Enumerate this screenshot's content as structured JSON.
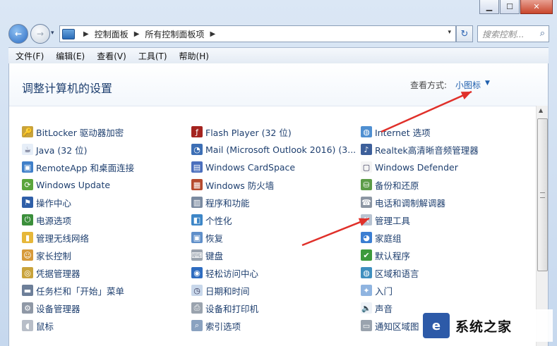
{
  "window": {
    "minimize": "▁",
    "maximize": "☐",
    "close": "✕"
  },
  "nav": {
    "back": "←",
    "forward": "→",
    "history": "▾",
    "breadcrumb": [
      "控制面板",
      "所有控制面板项"
    ],
    "crumb_sep": "▶",
    "dropdown": "▾",
    "refresh": "↻",
    "search_placeholder": "搜索控制...",
    "search_icon": "⌕"
  },
  "menu": [
    "文件(F)",
    "编辑(E)",
    "查看(V)",
    "工具(T)",
    "帮助(H)"
  ],
  "header": {
    "title": "调整计算机的设置",
    "view_label": "查看方式:",
    "view_value": "小图标",
    "view_caret": "▼"
  },
  "scrollbar": {
    "up": "▲"
  },
  "columns": [
    [
      {
        "label": "BitLocker 驱动器加密",
        "icon": "bitlocker-icon",
        "glyph": "🔑",
        "color": "#c9a33b"
      },
      {
        "label": "Java (32 位)",
        "icon": "java-icon",
        "glyph": "☕",
        "color": "#e6eef8"
      },
      {
        "label": "RemoteApp 和桌面连接",
        "icon": "remoteapp-icon",
        "glyph": "▣",
        "color": "#3f7fc9"
      },
      {
        "label": "Windows Update",
        "icon": "windows-update-icon",
        "glyph": "⟳",
        "color": "#5aa53c"
      },
      {
        "label": "操作中心",
        "icon": "action-center-icon",
        "glyph": "⚑",
        "color": "#2f5fa8"
      },
      {
        "label": "电源选项",
        "icon": "power-options-icon",
        "glyph": "⏻",
        "color": "#3b8f3b"
      },
      {
        "label": "管理无线网络",
        "icon": "wireless-icon",
        "glyph": "▮",
        "color": "#e6b73a"
      },
      {
        "label": "家长控制",
        "icon": "parental-controls-icon",
        "glyph": "☺",
        "color": "#d79a3a"
      },
      {
        "label": "凭据管理器",
        "icon": "credential-manager-icon",
        "glyph": "◎",
        "color": "#c9a33b"
      },
      {
        "label": "任务栏和「开始」菜单",
        "icon": "taskbar-icon",
        "glyph": "▬",
        "color": "#6d7f99"
      },
      {
        "label": "设备管理器",
        "icon": "device-manager-icon",
        "glyph": "⚙",
        "color": "#8f98a6"
      },
      {
        "label": "鼠标",
        "icon": "mouse-icon",
        "glyph": "◖",
        "color": "#b8bec8"
      }
    ],
    [
      {
        "label": "Flash Player (32 位)",
        "icon": "flash-player-icon",
        "glyph": "ƒ",
        "color": "#a4231f"
      },
      {
        "label": "Mail (Microsoft Outlook 2016) (3...",
        "icon": "mail-icon",
        "glyph": "◔",
        "color": "#3d6fb5"
      },
      {
        "label": "Windows CardSpace",
        "icon": "cardspace-icon",
        "glyph": "▤",
        "color": "#4b6fbd"
      },
      {
        "label": "Windows 防火墙",
        "icon": "firewall-icon",
        "glyph": "▦",
        "color": "#b64b2e"
      },
      {
        "label": "程序和功能",
        "icon": "programs-features-icon",
        "glyph": "▥",
        "color": "#7a8aa0"
      },
      {
        "label": "个性化",
        "icon": "personalization-icon",
        "glyph": "◧",
        "color": "#3d86c7"
      },
      {
        "label": "恢复",
        "icon": "recovery-icon",
        "glyph": "▣",
        "color": "#5f8fc9"
      },
      {
        "label": "键盘",
        "icon": "keyboard-icon",
        "glyph": "⌨",
        "color": "#9aa3ae"
      },
      {
        "label": "轻松访问中心",
        "icon": "ease-of-access-icon",
        "glyph": "◉",
        "color": "#2e6cc0"
      },
      {
        "label": "日期和时间",
        "icon": "date-time-icon",
        "glyph": "◷",
        "color": "#c8d7ea"
      },
      {
        "label": "设备和打印机",
        "icon": "devices-printers-icon",
        "glyph": "⎙",
        "color": "#9aa3ae"
      },
      {
        "label": "索引选项",
        "icon": "indexing-options-icon",
        "glyph": "⌕",
        "color": "#8aa2c0"
      }
    ],
    [
      {
        "label": "Internet 选项",
        "icon": "internet-options-icon",
        "glyph": "◍",
        "color": "#4f8fd1"
      },
      {
        "label": "Realtek高清晰音频管理器",
        "icon": "realtek-audio-icon",
        "glyph": "♪",
        "color": "#3d5f9a"
      },
      {
        "label": "Windows Defender",
        "icon": "windows-defender-icon",
        "glyph": "▢",
        "color": "#f4f4f4"
      },
      {
        "label": "备份和还原",
        "icon": "backup-restore-icon",
        "glyph": "⛁",
        "color": "#5c9c48"
      },
      {
        "label": "电话和调制解调器",
        "icon": "phone-modem-icon",
        "glyph": "☎",
        "color": "#8c96a3"
      },
      {
        "label": "管理工具",
        "icon": "admin-tools-icon",
        "glyph": "⚒",
        "color": "#b8c3d1"
      },
      {
        "label": "家庭组",
        "icon": "homegroup-icon",
        "glyph": "◕",
        "color": "#3b7ed2"
      },
      {
        "label": "默认程序",
        "icon": "default-programs-icon",
        "glyph": "✔",
        "color": "#3c9a3c"
      },
      {
        "label": "区域和语言",
        "icon": "region-language-icon",
        "glyph": "◍",
        "color": "#3f8fbf"
      },
      {
        "label": "入门",
        "icon": "getting-started-icon",
        "glyph": "✦",
        "color": "#8fb4e0"
      },
      {
        "label": "声音",
        "icon": "sound-icon",
        "glyph": "🔈",
        "color": "#eef2f7"
      },
      {
        "label": "通知区域图",
        "icon": "notification-area-icon",
        "glyph": "▭",
        "color": "#9aa3ae"
      }
    ]
  ],
  "watermark": {
    "logo": "e",
    "text": "系统之家"
  },
  "colors": {
    "link": "#1e3f6f",
    "accent": "#1f5fad",
    "arrow": "#e0302a"
  }
}
